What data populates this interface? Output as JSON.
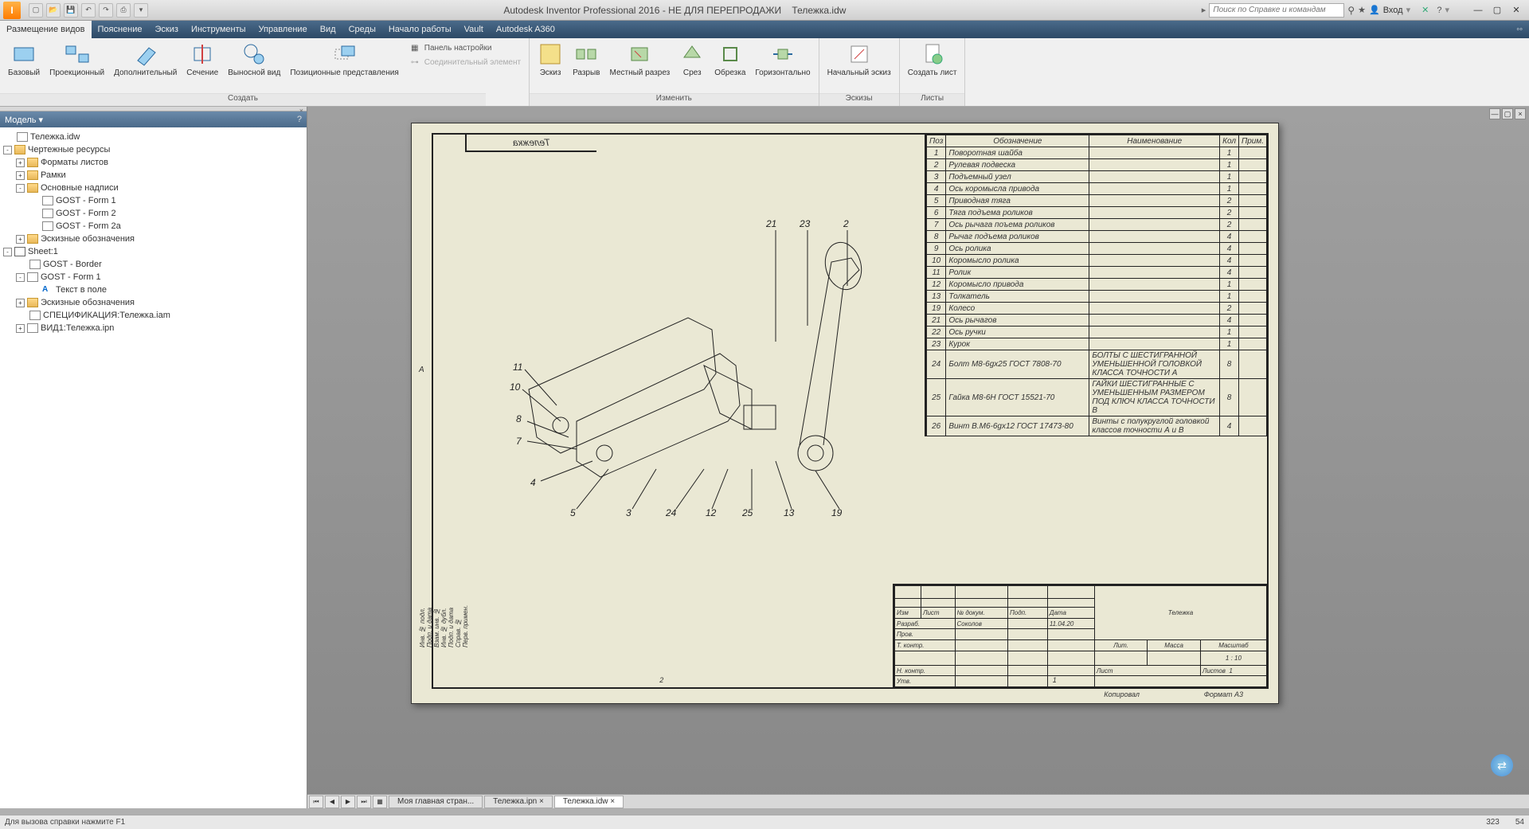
{
  "app": {
    "title_prefix": "Autodesk Inventor Professional 2016 - НЕ ДЛЯ ПЕРЕПРОДАЖИ",
    "document": "Тележка.idw",
    "search_placeholder": "Поиск по Справке и командам",
    "login_label": "Вход"
  },
  "menubar": [
    "Размещение видов",
    "Пояснение",
    "Эскиз",
    "Инструменты",
    "Управление",
    "Вид",
    "Среды",
    "Начало работы",
    "Vault",
    "Autodesk A360"
  ],
  "ribbon": {
    "groups": [
      {
        "label": "Создать",
        "buttons": [
          {
            "name": "base-view",
            "label": "Базовый"
          },
          {
            "name": "projected-view",
            "label": "Проекционный"
          },
          {
            "name": "auxiliary-view",
            "label": "Дополнительный"
          },
          {
            "name": "section-view",
            "label": "Сечение"
          },
          {
            "name": "detail-view",
            "label": "Выносной вид"
          },
          {
            "name": "overlay-view",
            "label": "Позиционные представления"
          }
        ],
        "panel_items": [
          {
            "name": "panel-settings",
            "label": "Панель настройки"
          },
          {
            "name": "connector",
            "label": "Соединительный элемент",
            "disabled": true
          }
        ]
      },
      {
        "label": "Изменить",
        "buttons": [
          {
            "name": "sketch",
            "label": "Эскиз"
          },
          {
            "name": "break",
            "label": "Разрыв"
          },
          {
            "name": "breakout",
            "label": "Местный разрез"
          },
          {
            "name": "slice",
            "label": "Срез"
          },
          {
            "name": "crop",
            "label": "Обрезка"
          },
          {
            "name": "horizontal",
            "label": "Горизонтально"
          }
        ]
      },
      {
        "label": "Эскизы",
        "buttons": [
          {
            "name": "start-sketch",
            "label": "Начальный эскиз"
          }
        ]
      },
      {
        "label": "Листы",
        "buttons": [
          {
            "name": "new-sheet",
            "label": "Создать лист"
          }
        ]
      }
    ]
  },
  "panel": {
    "title": "Модель"
  },
  "tree": [
    {
      "depth": 0,
      "toggle": "",
      "icon": "file",
      "label": "Тележка.idw"
    },
    {
      "depth": 0,
      "toggle": "-",
      "icon": "folder",
      "label": "Чертежные ресурсы"
    },
    {
      "depth": 1,
      "toggle": "+",
      "icon": "folder",
      "label": "Форматы листов"
    },
    {
      "depth": 1,
      "toggle": "+",
      "icon": "folder",
      "label": "Рамки"
    },
    {
      "depth": 1,
      "toggle": "-",
      "icon": "folder",
      "label": "Основные надписи"
    },
    {
      "depth": 2,
      "toggle": "",
      "icon": "file",
      "label": "GOST - Form 1"
    },
    {
      "depth": 2,
      "toggle": "",
      "icon": "file",
      "label": "GOST - Form 2"
    },
    {
      "depth": 2,
      "toggle": "",
      "icon": "file",
      "label": "GOST - Form 2a"
    },
    {
      "depth": 1,
      "toggle": "+",
      "icon": "folder",
      "label": "Эскизные обозначения"
    },
    {
      "depth": 0,
      "toggle": "-",
      "icon": "sheet",
      "label": "Sheet:1"
    },
    {
      "depth": 1,
      "toggle": "",
      "icon": "file",
      "label": "GOST - Border"
    },
    {
      "depth": 1,
      "toggle": "-",
      "icon": "file",
      "label": "GOST - Form 1"
    },
    {
      "depth": 2,
      "toggle": "",
      "icon": "text",
      "label": "Текст в поле"
    },
    {
      "depth": 1,
      "toggle": "+",
      "icon": "folder",
      "label": "Эскизные обозначения"
    },
    {
      "depth": 1,
      "toggle": "",
      "icon": "file",
      "label": "СПЕЦИФИКАЦИЯ:Тележка.iam"
    },
    {
      "depth": 1,
      "toggle": "+",
      "icon": "file",
      "label": "ВИД1:Тележка.ipn"
    }
  ],
  "parts_header": {
    "pos": "Поз",
    "desig": "Обозначение",
    "name": "Наименование",
    "qty": "Кол",
    "note": "Прим."
  },
  "parts": [
    {
      "pos": "1",
      "desig": "Поворотная шайба",
      "name": "",
      "qty": "1",
      "note": ""
    },
    {
      "pos": "2",
      "desig": "Рулевая подвеска",
      "name": "",
      "qty": "1",
      "note": ""
    },
    {
      "pos": "3",
      "desig": "Подъемный узел",
      "name": "",
      "qty": "1",
      "note": ""
    },
    {
      "pos": "4",
      "desig": "Ось коромысла привода",
      "name": "",
      "qty": "1",
      "note": ""
    },
    {
      "pos": "5",
      "desig": "Приводная тяга",
      "name": "",
      "qty": "2",
      "note": ""
    },
    {
      "pos": "6",
      "desig": "Тяга подъема роликов",
      "name": "",
      "qty": "2",
      "note": ""
    },
    {
      "pos": "7",
      "desig": "Ось рычага поъема роликов",
      "name": "",
      "qty": "2",
      "note": ""
    },
    {
      "pos": "8",
      "desig": "Рычаг подъема роликов",
      "name": "",
      "qty": "4",
      "note": ""
    },
    {
      "pos": "9",
      "desig": "Ось ролика",
      "name": "",
      "qty": "4",
      "note": ""
    },
    {
      "pos": "10",
      "desig": "Коромысло ролика",
      "name": "",
      "qty": "4",
      "note": ""
    },
    {
      "pos": "11",
      "desig": "Ролик",
      "name": "",
      "qty": "4",
      "note": ""
    },
    {
      "pos": "12",
      "desig": "Коромысло привода",
      "name": "",
      "qty": "1",
      "note": ""
    },
    {
      "pos": "13",
      "desig": "Толкатель",
      "name": "",
      "qty": "1",
      "note": ""
    },
    {
      "pos": "19",
      "desig": "Колесо",
      "name": "",
      "qty": "2",
      "note": ""
    },
    {
      "pos": "21",
      "desig": "Ось рычагов",
      "name": "",
      "qty": "4",
      "note": ""
    },
    {
      "pos": "22",
      "desig": "Ось ручки",
      "name": "",
      "qty": "1",
      "note": ""
    },
    {
      "pos": "23",
      "desig": "Курок",
      "name": "",
      "qty": "1",
      "note": ""
    },
    {
      "pos": "24",
      "desig": "Болт M8-6gx25 ГОСТ 7808-70",
      "name": "БОЛТЫ С ШЕСТИГРАННОЙ УМЕНЬШЕННОЙ ГОЛОВКОЙ КЛАССА ТОЧНОСТИ А",
      "qty": "8",
      "note": ""
    },
    {
      "pos": "25",
      "desig": "Гайка M8-6H ГОСТ 15521-70",
      "name": "ГАЙКИ ШЕСТИГРАННЫЕ С УМЕНЬШЕННЫМ РАЗМЕРОМ  ПОД КЛЮЧ КЛАССА ТОЧНОСТИ В",
      "qty": "8",
      "note": ""
    },
    {
      "pos": "26",
      "desig": "Винт B.M6-6gx12 ГОСТ 17473-80",
      "name": "Винты с полукруглой головкой классов точности А и В",
      "qty": "4",
      "note": ""
    }
  ],
  "title_block": {
    "main": "Тележка",
    "rows": [
      "Изм",
      "Лист",
      "№ докум.",
      "Подп.",
      "Дата"
    ],
    "dev": "Разраб.",
    "dev_name": "Соколов",
    "dev_date": "11.04.20",
    "check": "Пров.",
    "tcontrol": "Т. контр.",
    "ncontrol": "Н. контр.",
    "approve": "Утв.",
    "lit": "Лит.",
    "mass": "Масса",
    "scale": "Масштаб",
    "scale_val": "1 : 10",
    "sheet": "Лист",
    "sheets": "Листов",
    "sheets_val": "1",
    "copied": "Копировал",
    "format": "Формат А3"
  },
  "callouts_top": [
    "21",
    "23",
    "2"
  ],
  "callouts_left": [
    "11",
    "10",
    "8",
    "7",
    "4"
  ],
  "callouts_bottom": [
    "5",
    "3",
    "24",
    "12",
    "25",
    "13",
    "19"
  ],
  "doc_tabs": [
    {
      "label": "Моя главная стран...",
      "active": false
    },
    {
      "label": "Тележка.ipn",
      "active": false
    },
    {
      "label": "Тележка.idw",
      "active": true
    }
  ],
  "statusbar": {
    "hint": "Для вызова справки нажмите F1",
    "coord1": "323",
    "coord2": "54"
  },
  "sheet_title": "Тележка",
  "ruler": [
    "2",
    "1"
  ]
}
